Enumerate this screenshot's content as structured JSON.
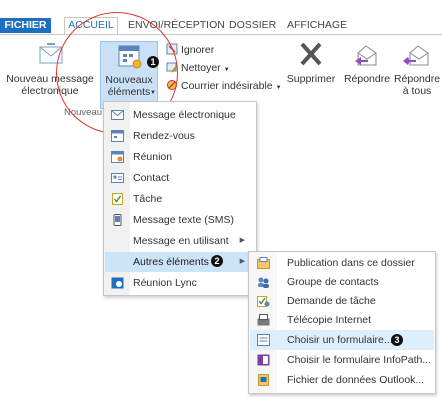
{
  "tabs": [
    {
      "label": "FICHIER"
    },
    {
      "label": "ACCUEIL"
    },
    {
      "label": "ENVOI/RÉCEPTION"
    },
    {
      "label": "DOSSIER"
    },
    {
      "label": "AFFICHAGE"
    }
  ],
  "ribbon": {
    "new_message": {
      "line1": "Nouveau message",
      "line2": "électronique"
    },
    "new_items": {
      "line1": "Nouveaux",
      "line2": "éléments"
    },
    "ignore": "Ignorer",
    "clean": "Nettoyer",
    "junk": "Courrier indésirable",
    "delete": "Supprimer",
    "reply": "Répondre",
    "reply_all": {
      "line1": "Répondre",
      "line2": "à tous"
    },
    "group_label": "Nouveau"
  },
  "callouts": {
    "one": "1",
    "two": "2",
    "three": "3"
  },
  "menu1": [
    {
      "label": "Message électronique"
    },
    {
      "label": "Rendez-vous"
    },
    {
      "label": "Réunion"
    },
    {
      "label": "Contact"
    },
    {
      "label": "Tâche"
    },
    {
      "label": "Message texte (SMS)"
    },
    {
      "label": "Message en utilisant"
    },
    {
      "label": "Autres éléments"
    },
    {
      "label": "Réunion Lync"
    }
  ],
  "menu2": [
    {
      "label": "Publication dans ce dossier"
    },
    {
      "label": "Groupe de contacts"
    },
    {
      "label": "Demande de tâche"
    },
    {
      "label": "Télécopie Internet"
    },
    {
      "label": "Choisir un formulaire..."
    },
    {
      "label": "Choisir le formulaire InfoPath..."
    },
    {
      "label": "Fichier de données Outlook..."
    }
  ],
  "colors": {
    "file_tab": "#1e6fc0",
    "highlight": "#cce4f7",
    "callout": "#d9392c"
  }
}
